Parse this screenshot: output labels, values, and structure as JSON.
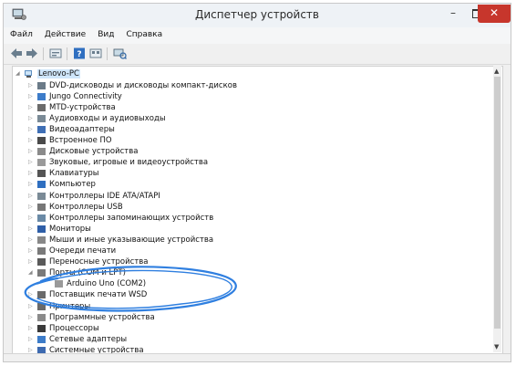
{
  "window": {
    "title": "Диспетчер устройств",
    "minimize_glyph": "–",
    "close_glyph": "✕"
  },
  "menu": [
    "Файл",
    "Действие",
    "Вид",
    "Справка"
  ],
  "toolbar_icons": [
    "back-arrow-icon",
    "forward-arrow-icon",
    "properties-icon",
    "help-icon",
    "view-icon",
    "scan-hardware-icon"
  ],
  "tree": {
    "root": "Lenovo-PC",
    "categories": [
      "DVD-дисководы и дисководы компакт-дисков",
      "Jungo Connectivity",
      "MTD-устройства",
      "Аудиовходы и аудиовыходы",
      "Видеоадаптеры",
      "Встроенное ПО",
      "Дисковые устройства",
      "Звуковые, игровые и видеоустройства",
      "Клавиатуры",
      "Компьютер",
      "Контроллеры IDE ATA/ATAPI",
      "Контроллеры USB",
      "Контроллеры запоминающих устройств",
      "Мониторы",
      "Мыши и иные указывающие устройства",
      "Очереди печати",
      "Переносные устройства",
      "Порты (COM и LPT)",
      "Arduino Uno (COM2)",
      "Поставщик печати WSD",
      "Принтеры",
      "Программные устройства",
      "Процессоры",
      "Сетевые адаптеры",
      "Системные устройства"
    ]
  },
  "annotation_color": "#2f7fe0"
}
